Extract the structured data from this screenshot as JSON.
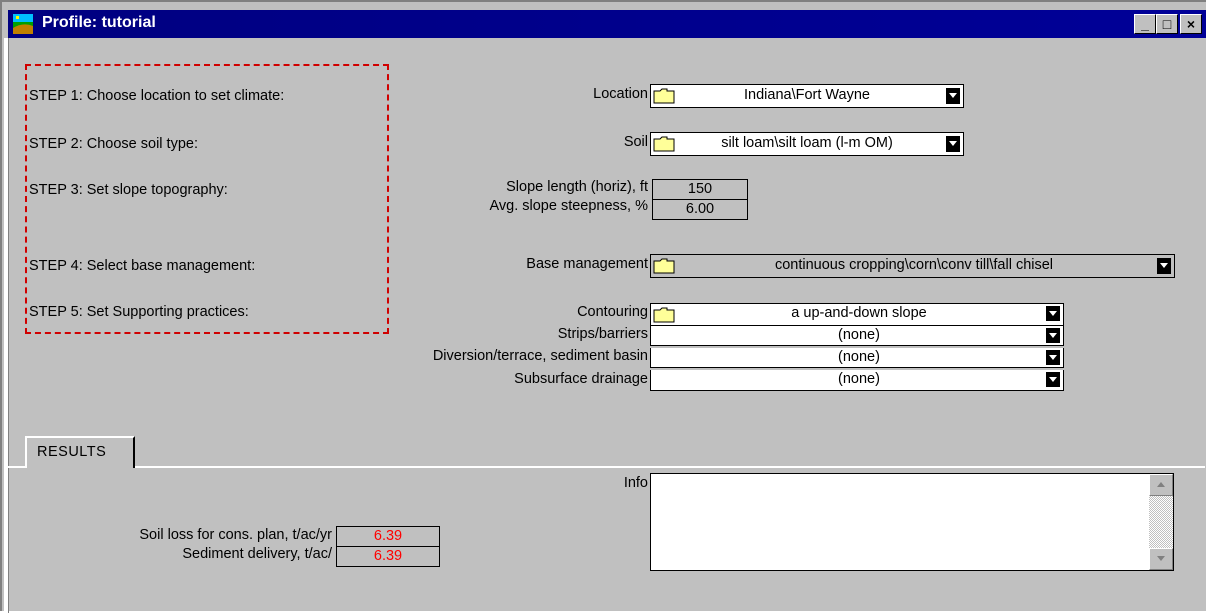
{
  "window": {
    "title": "Profile:  tutorial",
    "min_label": "_",
    "max_label": "□",
    "close_label": "×"
  },
  "steps": [
    {
      "label": "STEP 1: Choose location to set climate:"
    },
    {
      "label": "STEP 2: Choose soil type:"
    },
    {
      "label": "STEP 3: Set slope topography:"
    },
    {
      "label": "STEP 4: Select base management:"
    },
    {
      "label": "STEP 5: Set Supporting practices:"
    }
  ],
  "location": {
    "label": "Location",
    "value": "Indiana\\Fort Wayne"
  },
  "soil": {
    "label": "Soil",
    "value": "silt loam\\silt loam (l-m OM)"
  },
  "slope": {
    "length_label": "Slope length (horiz), ft",
    "length_value": "150",
    "steepness_label": "Avg. slope steepness, %",
    "steepness_value": "6.00"
  },
  "base_management": {
    "label": "Base management",
    "value": "continuous cropping\\corn\\conv till\\fall chisel"
  },
  "supporting": {
    "contouring_label": "Contouring",
    "contouring_value": "a up-and-down slope",
    "strips_label": "Strips/barriers",
    "strips_value": "(none)",
    "diversion_label": "Diversion/terrace, sediment basin",
    "diversion_value": "(none)",
    "drainage_label": "Subsurface drainage",
    "drainage_value": "(none)"
  },
  "results": {
    "tab_label": "RESULTS",
    "info_label": "Info",
    "info_text": "",
    "soil_loss_label": "Soil loss for cons. plan, t/ac/yr",
    "soil_loss_value": "6.39",
    "sediment_label": "Sediment delivery, t/ac/",
    "sediment_value": "6.39"
  },
  "colors": {
    "title_bar": "#000080",
    "window_bg": "#c0c0c0",
    "highlight": "#ff0000",
    "step_border": "#d00000"
  },
  "icons": {
    "app": "app-icon",
    "folder": "folder-icon",
    "dropdown": "dropdown-arrow-icon"
  }
}
